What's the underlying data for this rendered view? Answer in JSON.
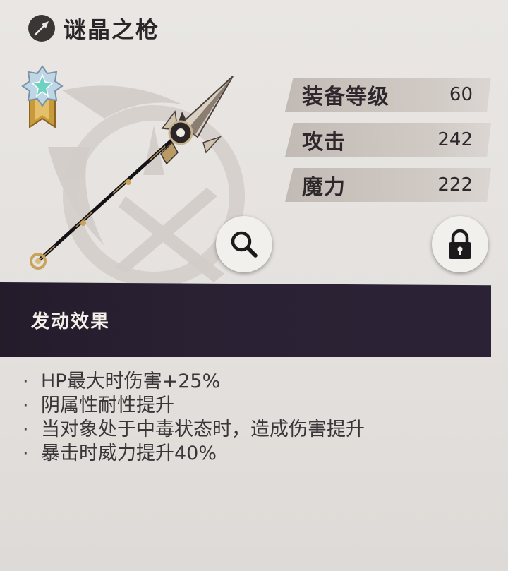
{
  "item": {
    "name": "谜晶之枪"
  },
  "stats": [
    {
      "label": "装备等级",
      "value": "60"
    },
    {
      "label": "攻击",
      "value": "242"
    },
    {
      "label": "魔力",
      "value": "222"
    }
  ],
  "effect_section": {
    "title": "发动效果",
    "lines": [
      "HP最大时伤害+25%",
      "阴属性耐性提升",
      "当对象处于中毒状态时，造成伤害提升",
      "暴击时威力提升40%"
    ]
  },
  "icons": {
    "weapon_type": "spear-type-icon",
    "rank": "rank-badge-icon",
    "zoom": "magnifier-icon",
    "lock": "lock-icon"
  }
}
